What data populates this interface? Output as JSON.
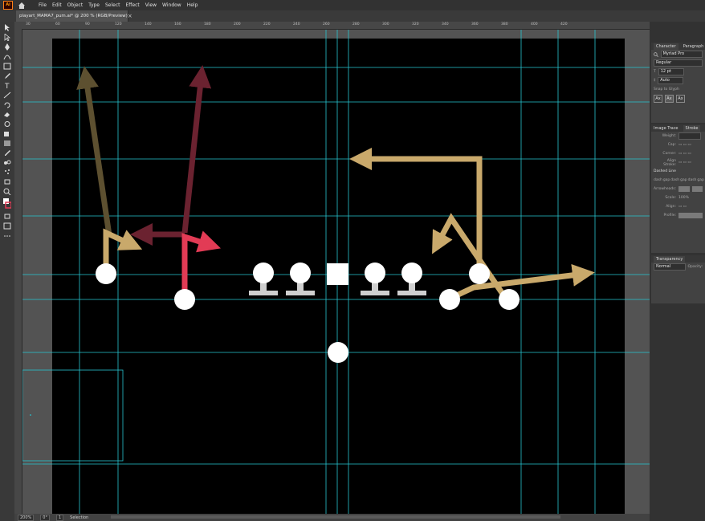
{
  "app": {
    "logo": "Ai"
  },
  "menu": [
    "File",
    "Edit",
    "Object",
    "Type",
    "Select",
    "Effect",
    "View",
    "Window",
    "Help"
  ],
  "document": {
    "tab_title": "playart_MAMA7_pum.ai* @ 200 % (RGB/Preview)",
    "close_glyph": "×"
  },
  "ruler": {
    "top_ticks": [
      "30",
      "60",
      "90",
      "120",
      "140",
      "160",
      "180",
      "200",
      "220",
      "240",
      "260",
      "280",
      "300",
      "320",
      "340",
      "360",
      "380",
      "400",
      "420"
    ]
  },
  "colors": {
    "artboard": "#000000",
    "guide": "#27c4d0",
    "route_gold": "#c9a96b",
    "route_olive": "#5d5030",
    "route_maroon": "#6b2230",
    "route_red": "#e23b55",
    "player": "#ffffff",
    "lineman_base": "#cfcfcf"
  },
  "character_panel": {
    "tabs": [
      "Character",
      "Paragraph"
    ],
    "font_family": "Myriad Pro",
    "font_style": "Regular",
    "font_size": "12 pt",
    "leading": "Auto",
    "snap_label": "Snap to Glyph",
    "glyphs": [
      "Ax",
      "Ax",
      "Ax"
    ]
  },
  "stroke_panel": {
    "tabs": [
      "Image Trace",
      "Stroke"
    ],
    "weight_label": "Weight:",
    "cap_label": "Cap:",
    "corner_label": "Corner:",
    "align_label": "Align Stroke:",
    "dashed_label": "Dashed Line",
    "dash_labels": [
      "dash",
      "gap",
      "dash",
      "gap",
      "dash",
      "gap"
    ],
    "arrowheads_label": "Arrowheads:",
    "scale_label": "Scale:",
    "scale_value": "100%",
    "align_arrow_label": "Align:",
    "profile_label": "Profile:"
  },
  "transparency_panel": {
    "tab": "Transparency",
    "blend_mode": "Normal",
    "opacity_label": "Opacity:"
  },
  "status": {
    "zoom": "200%",
    "rotation": "0°",
    "artboard_nav": "1",
    "tool": "Selection"
  }
}
